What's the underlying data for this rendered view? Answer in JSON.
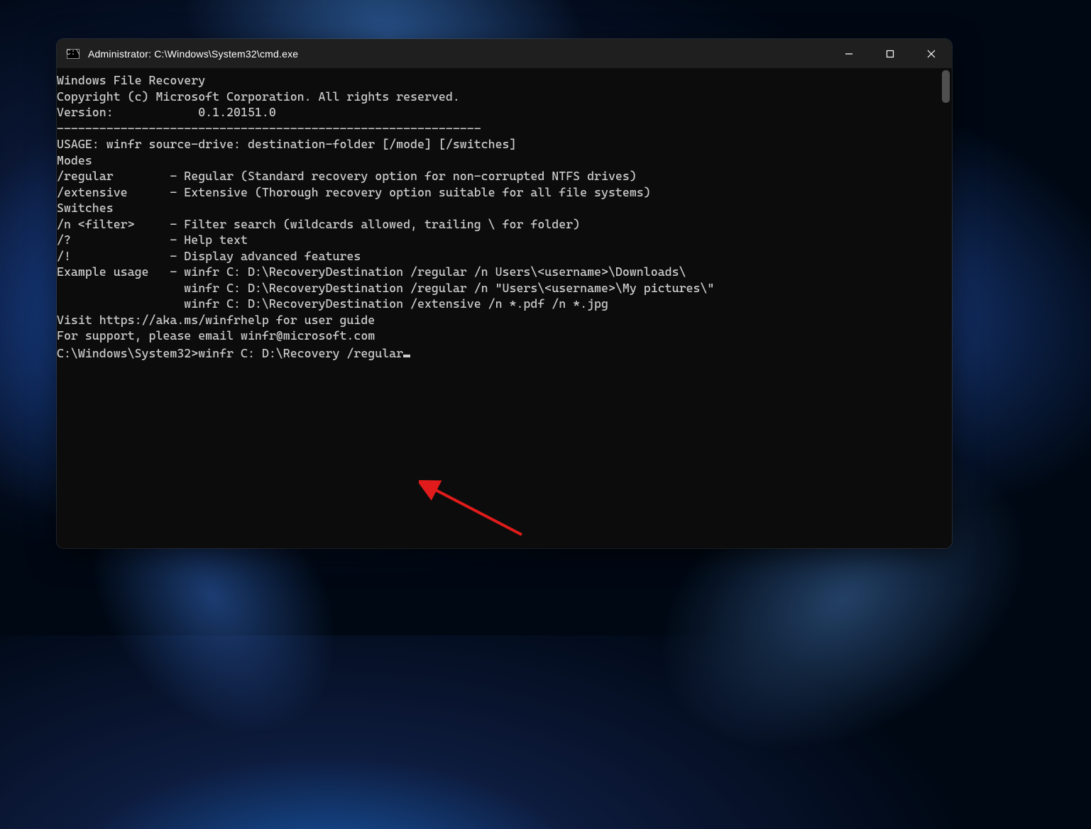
{
  "window": {
    "title": "Administrator: C:\\Windows\\System32\\cmd.exe",
    "icon_glyph": "C:\\"
  },
  "terminal": {
    "lines": [
      "Windows File Recovery",
      "Copyright (c) Microsoft Corporation. All rights reserved.",
      "Version:            0.1.20151.0",
      "------------------------------------------------------------",
      "",
      "USAGE: winfr source-drive: destination-folder [/mode] [/switches]",
      "",
      "Modes",
      "/regular        - Regular (Standard recovery option for non-corrupted NTFS drives)",
      "/extensive      - Extensive (Thorough recovery option suitable for all file systems)",
      "",
      "Switches",
      "/n <filter>     - Filter search (wildcards allowed, trailing \\ for folder)",
      "/?              - Help text",
      "/!              - Display advanced features",
      "",
      "Example usage   - winfr C: D:\\RecoveryDestination /regular /n Users\\<username>\\Downloads\\",
      "                  winfr C: D:\\RecoveryDestination /regular /n \"Users\\<username>\\My pictures\\\"",
      "                  winfr C: D:\\RecoveryDestination /extensive /n *.pdf /n *.jpg",
      "",
      "",
      "Visit https://aka.ms/winfrhelp for user guide",
      "For support, please email winfr@microsoft.com",
      ""
    ],
    "prompt": "C:\\Windows\\System32>",
    "current_command": "winfr C: D:\\Recovery /regular"
  },
  "annotation": {
    "arrow_color": "#e11b1b"
  }
}
